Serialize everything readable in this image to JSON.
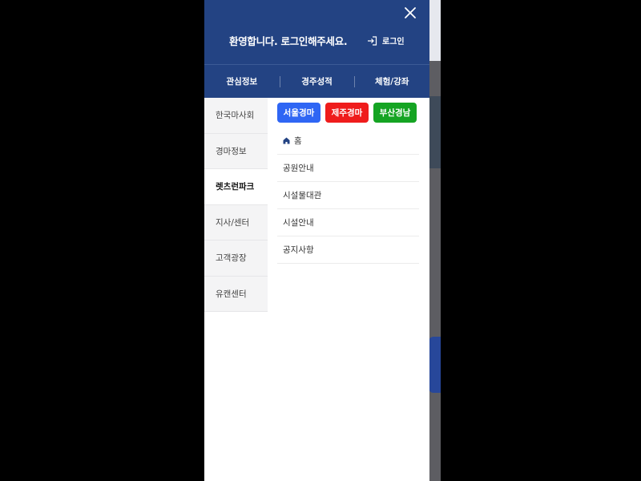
{
  "header": {
    "welcome_text": "환영합니다. 로그인해주세요.",
    "login_label": "로그인"
  },
  "tabs": [
    {
      "label": "관심정보"
    },
    {
      "label": "경주성적"
    },
    {
      "label": "체험/강좌"
    }
  ],
  "sidebar": {
    "items": [
      {
        "label": "한국마사회"
      },
      {
        "label": "경마정보"
      },
      {
        "label": "렛츠런파크"
      },
      {
        "label": "지사/센터"
      },
      {
        "label": "고객광장"
      },
      {
        "label": "유캔센터"
      }
    ],
    "active": "렛츠런파크"
  },
  "parks": [
    {
      "label": "서울경마",
      "color": "#2f66f4"
    },
    {
      "label": "제주경마",
      "color": "#ef1c1c"
    },
    {
      "label": "부산경남",
      "color": "#15a423"
    }
  ],
  "submenu": [
    {
      "label": "홈"
    },
    {
      "label": "공원안내"
    },
    {
      "label": "시설물대관"
    },
    {
      "label": "시설안내"
    },
    {
      "label": "공지사항"
    }
  ],
  "colors": {
    "header_bg": "#234383",
    "sidebar_bg": "#f4f4f5"
  }
}
